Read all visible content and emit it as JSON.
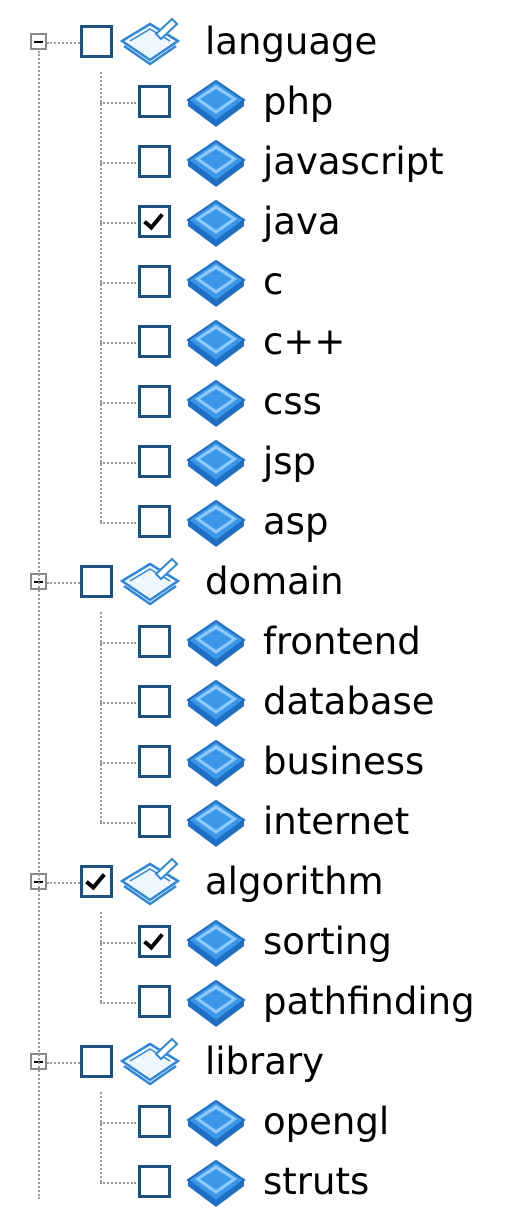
{
  "colors": {
    "checkbox_border": "#1c5180",
    "leaf_icon": "#3d97e8",
    "leaf_icon_highlight": "#8fcbff",
    "folder_icon_outline": "#2f86d8",
    "folder_icon_fill": "#eef6ff",
    "tree_line": "#9a9a9a"
  },
  "tree": [
    {
      "label": "language",
      "checked": false,
      "expanded": true,
      "icon": "open-book-icon",
      "children": [
        {
          "label": "php",
          "checked": false,
          "icon": "book-icon"
        },
        {
          "label": "javascript",
          "checked": false,
          "icon": "book-icon"
        },
        {
          "label": "java",
          "checked": true,
          "icon": "book-icon"
        },
        {
          "label": "c",
          "checked": false,
          "icon": "book-icon"
        },
        {
          "label": "c++",
          "checked": false,
          "icon": "book-icon"
        },
        {
          "label": "css",
          "checked": false,
          "icon": "book-icon"
        },
        {
          "label": "jsp",
          "checked": false,
          "icon": "book-icon"
        },
        {
          "label": "asp",
          "checked": false,
          "icon": "book-icon"
        }
      ]
    },
    {
      "label": "domain",
      "checked": false,
      "expanded": true,
      "icon": "open-book-icon",
      "children": [
        {
          "label": "frontend",
          "checked": false,
          "icon": "book-icon"
        },
        {
          "label": "database",
          "checked": false,
          "icon": "book-icon"
        },
        {
          "label": "business",
          "checked": false,
          "icon": "book-icon"
        },
        {
          "label": "internet",
          "checked": false,
          "icon": "book-icon"
        }
      ]
    },
    {
      "label": "algorithm",
      "checked": true,
      "expanded": true,
      "icon": "open-book-icon",
      "children": [
        {
          "label": "sorting",
          "checked": true,
          "icon": "book-icon"
        },
        {
          "label": "pathfinding",
          "checked": false,
          "icon": "book-icon"
        }
      ]
    },
    {
      "label": "library",
      "checked": false,
      "expanded": true,
      "icon": "open-book-icon",
      "children": [
        {
          "label": "opengl",
          "checked": false,
          "icon": "book-icon"
        },
        {
          "label": "struts",
          "checked": false,
          "icon": "book-icon"
        }
      ]
    }
  ]
}
